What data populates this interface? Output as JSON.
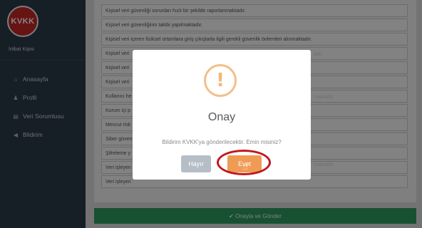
{
  "sidebar": {
    "logo_text": "KVKK",
    "user_label": "İrtibat Kişisi",
    "items": [
      {
        "icon": "home-icon",
        "glyph": "⌂",
        "label": "Anasayfa"
      },
      {
        "icon": "user-icon",
        "glyph": "♟",
        "label": "Profil"
      },
      {
        "icon": "database-icon",
        "glyph": "▤",
        "label": "Veri Sorumlusu"
      },
      {
        "icon": "megaphone-icon",
        "glyph": "◀",
        "label": "Bildirim"
      }
    ]
  },
  "checklist": [
    "Kişisel veri güvenliği sorunları hızlı bir şekilde raporlanmaktadır.",
    "Kişisel veri güvenliğinin takibi yapılmaktadır.",
    "Kişisel veri içeren fiziksel ortamlara giriş çıkışlarla ilgili gerekli güvenlik önlemleri alınmaktadır.",
    "Kişisel veri",
    "Kişisel veri",
    "Kişisel veri",
    "Kullanıcı he",
    "Kurum içi p",
    "Mevcut risk",
    "Siber güven",
    "Şifreleme y",
    "Veri işleyen",
    "Veri işleyen"
  ],
  "row_tails": {
    "3": "adır.",
    "6": "maktadır.",
    "11": "maktadır."
  },
  "submit_label": "✔ Onayla ve Gönder",
  "modal": {
    "icon_glyph": "!",
    "title": "Onay",
    "text": "Bildirim KVKK'ya gönderilecektir. Emin misiniz?",
    "cancel_label": "Hayır",
    "confirm_label": "Evet"
  },
  "colors": {
    "sidebar": "#2b3a4a",
    "submit": "#2e9b61",
    "confirm": "#ef9b55",
    "cancel": "#b5bec6",
    "highlight_ring": "#c0171d",
    "warning": "#f1c08b"
  }
}
